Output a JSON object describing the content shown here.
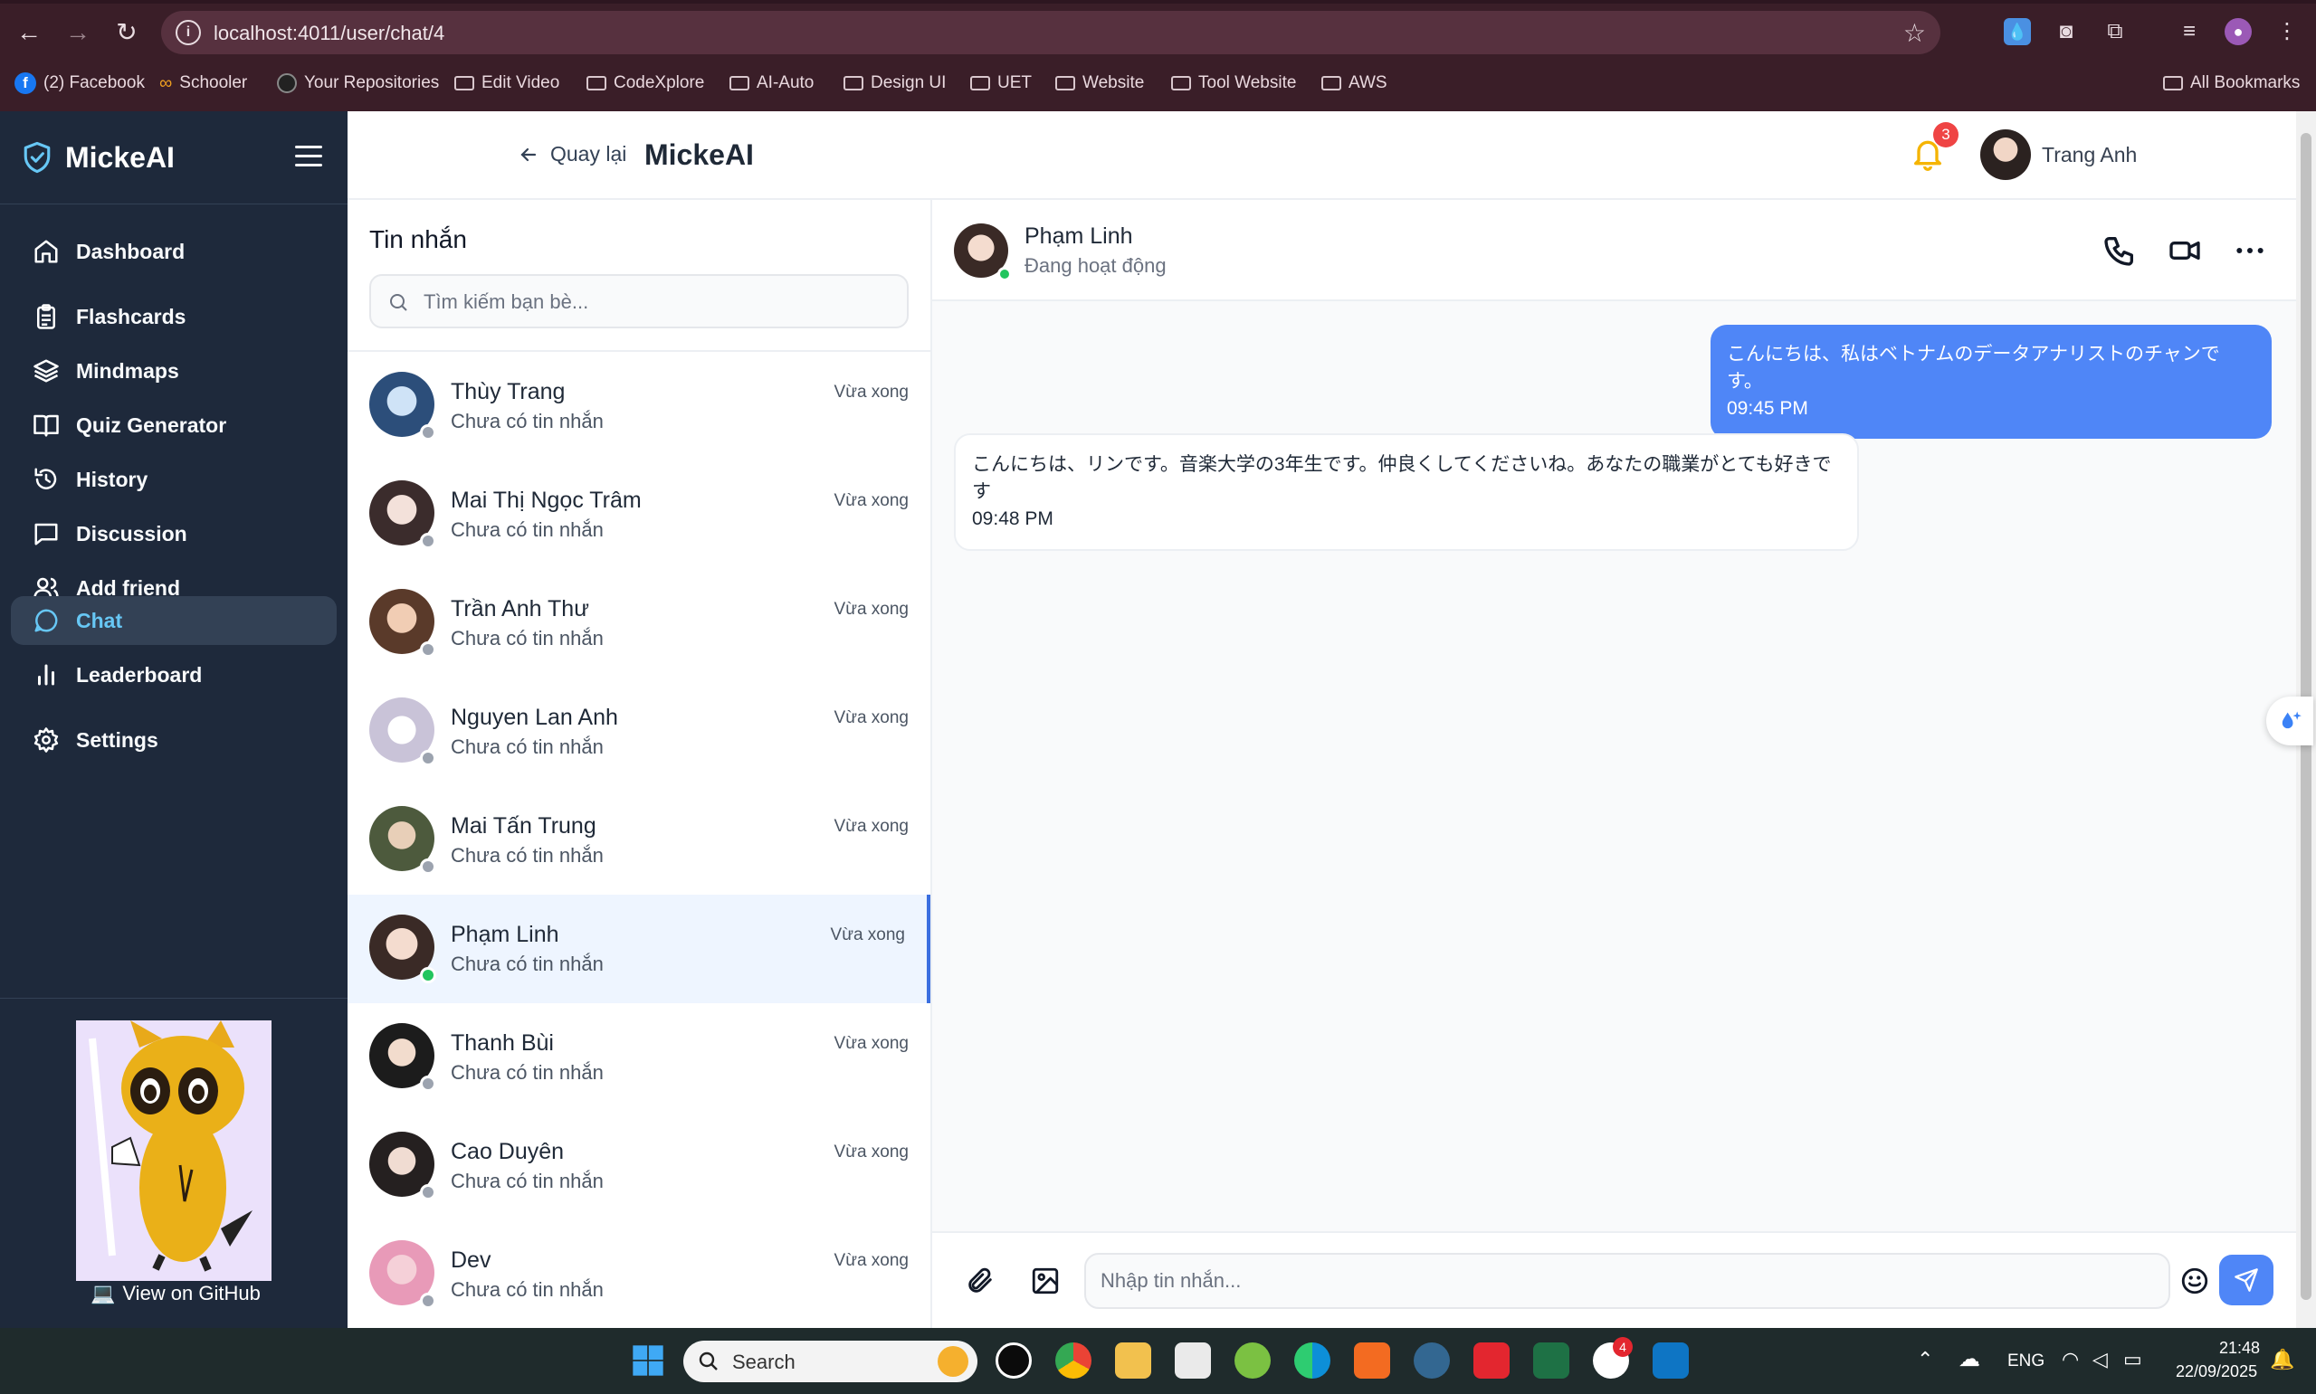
{
  "browser": {
    "url": "localhost:4011/user/chat/4",
    "bookmarks": [
      "(2) Facebook",
      "Schooler",
      "Your Repositories",
      "Edit Video",
      "CodeXplore",
      "AI-Auto",
      "Design UI",
      "UET",
      "Website",
      "Tool Website",
      "AWS"
    ],
    "all_bookmarks": "All Bookmarks"
  },
  "sidebar": {
    "brand": "MickeAI",
    "items": [
      {
        "label": "Dashboard",
        "icon": "home-icon"
      },
      {
        "label": "Flashcards",
        "icon": "clipboard-icon"
      },
      {
        "label": "Mindmaps",
        "icon": "layers-icon"
      },
      {
        "label": "Quiz Generator",
        "icon": "book-icon"
      },
      {
        "label": "History",
        "icon": "history-icon"
      },
      {
        "label": "Discussion",
        "icon": "message-square-icon"
      },
      {
        "label": "Add friend",
        "icon": "users-icon"
      },
      {
        "label": "Chat",
        "icon": "message-circle-icon",
        "active": true
      },
      {
        "label": "Leaderboard",
        "icon": "bar-chart-icon"
      },
      {
        "label": "Settings",
        "icon": "gear-icon"
      }
    ],
    "github_link": "View on GitHub"
  },
  "header": {
    "back_label": "Quay lại",
    "title": "MickeAI",
    "notification_count": "3",
    "user_name": "Trang Anh"
  },
  "contacts": {
    "title": "Tin nhắn",
    "search_placeholder": "Tìm kiếm bạn bè...",
    "list": [
      {
        "name": "Thùy Trang",
        "preview": "Chưa có tin nhắn",
        "time": "Vừa xong",
        "online": false
      },
      {
        "name": "Mai Thị Ngọc Trâm",
        "preview": "Chưa có tin nhắn",
        "time": "Vừa xong",
        "online": false
      },
      {
        "name": "Trần Anh Thư",
        "preview": "Chưa có tin nhắn",
        "time": "Vừa xong",
        "online": false
      },
      {
        "name": "Nguyen Lan Anh",
        "preview": "Chưa có tin nhắn",
        "time": "Vừa xong",
        "online": false
      },
      {
        "name": "Mai Tấn Trung",
        "preview": "Chưa có tin nhắn",
        "time": "Vừa xong",
        "online": false
      },
      {
        "name": "Phạm Linh",
        "preview": "Chưa có tin nhắn",
        "time": "Vừa xong",
        "online": true,
        "active": true
      },
      {
        "name": "Thanh Bùi",
        "preview": "Chưa có tin nhắn",
        "time": "Vừa xong",
        "online": false
      },
      {
        "name": "Cao Duyên",
        "preview": "Chưa có tin nhắn",
        "time": "Vừa xong",
        "online": false
      },
      {
        "name": "Dev",
        "preview": "Chưa có tin nhắn",
        "time": "Vừa xong",
        "online": false
      }
    ]
  },
  "chat": {
    "partner_name": "Phạm Linh",
    "partner_status": "Đang hoạt động",
    "messages": [
      {
        "direction": "out",
        "text": "こんにちは、私はベトナムのデータアナリストのチャンです。",
        "time": "09:45 PM"
      },
      {
        "direction": "in",
        "text": "こんにちは、リンです。音楽大学の3年生です。仲良くしてくださいね。あなたの職業がとても好きです",
        "time": "09:48 PM"
      }
    ],
    "input_placeholder": "Nhập tin nhắn..."
  },
  "taskbar": {
    "search_label": "Search",
    "language": "ENG",
    "time": "21:48",
    "date": "22/09/2025",
    "zalo_badge": "4"
  },
  "colors": {
    "sidebar_bg": "#1e293b",
    "accent_blue": "#4f86f7",
    "active_nav_text": "#67c7f5",
    "online_green": "#22c55e",
    "badge_red": "#ef4444"
  }
}
